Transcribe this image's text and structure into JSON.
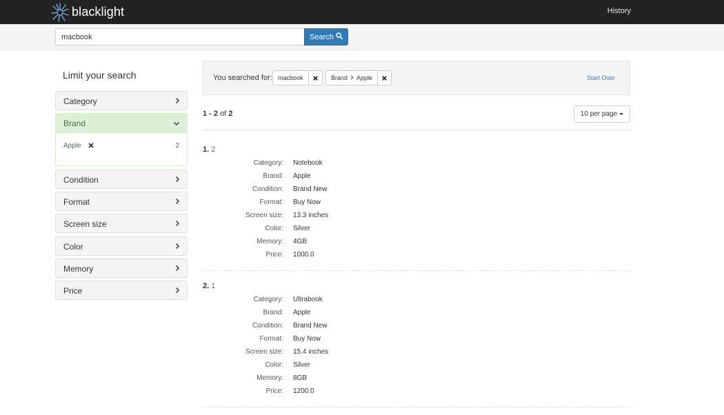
{
  "navbar": {
    "brand": "blacklight",
    "history": "History"
  },
  "search": {
    "query": "macbook",
    "button_label": "Search"
  },
  "sidebar": {
    "heading": "Limit your search",
    "facets": [
      {
        "label": "Category"
      },
      {
        "label": "Brand",
        "expanded": true,
        "values": [
          {
            "label": "Apple",
            "count": "2",
            "selected": true
          }
        ]
      },
      {
        "label": "Condition"
      },
      {
        "label": "Format"
      },
      {
        "label": "Screen size"
      },
      {
        "label": "Color"
      },
      {
        "label": "Memory"
      },
      {
        "label": "Price"
      }
    ]
  },
  "constraints": {
    "label": "You searched for:",
    "query": "macbook",
    "facet_field": "Brand",
    "facet_value": "Apple",
    "start_over": "Start Over"
  },
  "results": {
    "entries_prefix": "1 - 2",
    "entries_of": "of",
    "entries_total": "2",
    "per_page": "10 per page",
    "docs": [
      {
        "counter": "1.",
        "title": "2",
        "fields": [
          {
            "label": "Category:",
            "value": "Notebook"
          },
          {
            "label": "Brand:",
            "value": "Apple"
          },
          {
            "label": "Condition:",
            "value": "Brand New"
          },
          {
            "label": "Format:",
            "value": "Buy Now"
          },
          {
            "label": "Screen size:",
            "value": "13.3 inches"
          },
          {
            "label": "Color:",
            "value": "Silver"
          },
          {
            "label": "Memory:",
            "value": "4GB"
          },
          {
            "label": "Price:",
            "value": "1000.0"
          }
        ]
      },
      {
        "counter": "2.",
        "title": "1",
        "fields": [
          {
            "label": "Category:",
            "value": "Ultrabook"
          },
          {
            "label": "Brand:",
            "value": "Apple"
          },
          {
            "label": "Condition:",
            "value": "Brand New"
          },
          {
            "label": "Format:",
            "value": "Buy Now"
          },
          {
            "label": "Screen size:",
            "value": "15.4 inches"
          },
          {
            "label": "Color:",
            "value": "Silver"
          },
          {
            "label": "Memory:",
            "value": "8GB"
          },
          {
            "label": "Price:",
            "value": "1200.0"
          }
        ]
      }
    ]
  },
  "colors": {
    "navbar_bg": "#222222",
    "primary": "#337ab7",
    "facet_active_bg": "#dff0d8",
    "facet_active_text": "#3c763d"
  },
  "icons": {
    "logo": "blacklight-logo-icon",
    "search": "search-icon",
    "remove": "close-icon",
    "expand": "chevron-right-icon",
    "collapse": "chevron-down-icon"
  }
}
